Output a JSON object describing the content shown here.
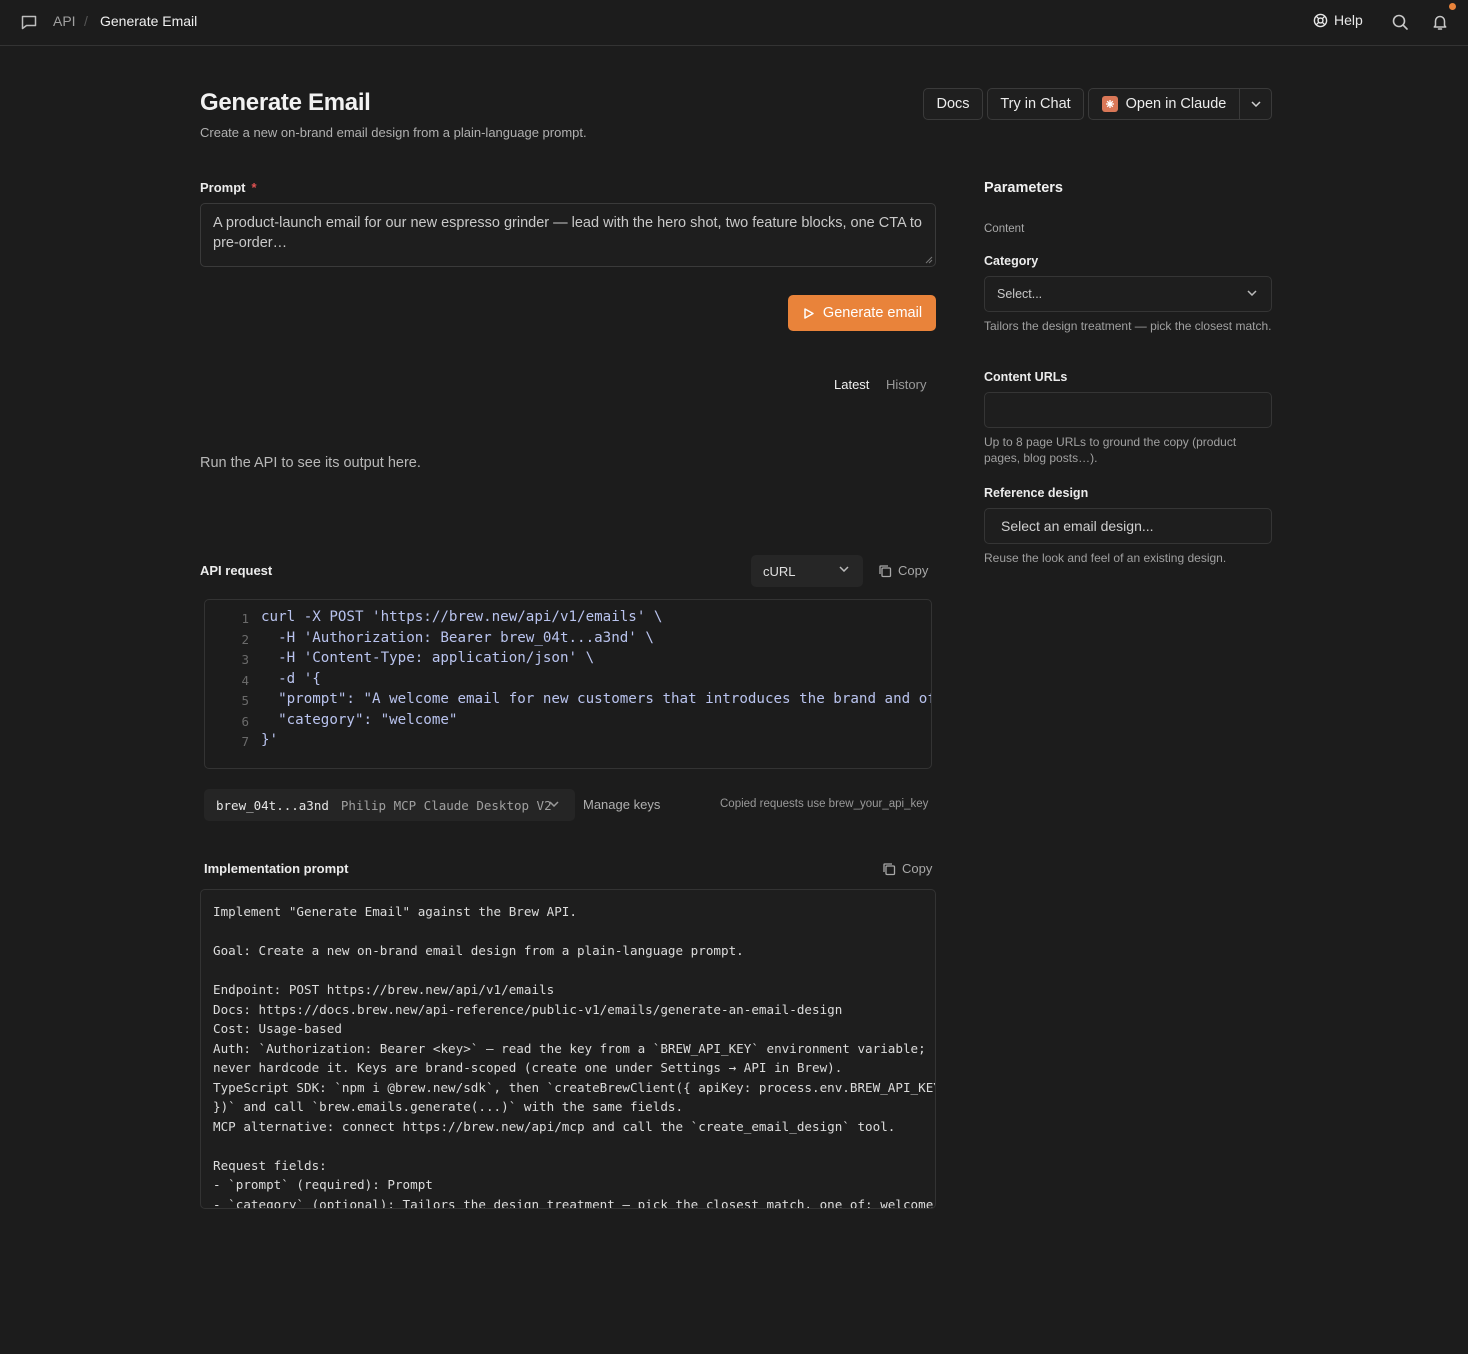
{
  "topbar": {
    "breadcrumb_root": "API",
    "breadcrumb_separator": "/",
    "breadcrumb_current": "Generate Email",
    "help_label": "Help",
    "icons": [
      "chat-bubble-icon",
      "lifebuoy-icon",
      "search-icon",
      "bell-icon"
    ],
    "notification_dot_color": "#e9833a"
  },
  "header": {
    "title": "Generate Email",
    "subtitle": "Create a new on-brand email design from a plain-language prompt.",
    "docs_label": "Docs",
    "try_chat_label": "Try in Chat",
    "open_claude_label": "Open in Claude"
  },
  "prompt": {
    "label": "Prompt",
    "required_mark": "*",
    "value": "A product-launch email for our new espresso grinder — lead with the hero shot, two feature blocks, one CTA to pre-order…",
    "generate_label": "Generate email"
  },
  "output": {
    "tab_latest": "Latest",
    "tab_history": "History",
    "empty_message": "Run the API to see its output here."
  },
  "api_request": {
    "label": "API request",
    "language": "cURL",
    "copy_label": "Copy",
    "code_lines": [
      "curl -X POST 'https://brew.new/api/v1/emails' \\",
      "  -H 'Authorization: Bearer brew_04t...a3nd' \\",
      "  -H 'Content-Type: application/json' \\",
      "  -d '{",
      "  \"prompt\": \"A welcome email for new customers that introduces the brand and offers",
      "  \"category\": \"welcome\"",
      "}'"
    ],
    "line_numbers": [
      "1",
      "2",
      "3",
      "4",
      "5",
      "6",
      "7"
    ],
    "key_id": "brew_04t...a3nd",
    "key_name": "Philip MCP Claude Desktop V2",
    "manage_keys_label": "Manage keys",
    "copied_note": "Copied requests use brew_your_api_key"
  },
  "implementation": {
    "label": "Implementation prompt",
    "copy_label": "Copy",
    "text": "Implement \"Generate Email\" against the Brew API.\n\nGoal: Create a new on-brand email design from a plain-language prompt.\n\nEndpoint: POST https://brew.new/api/v1/emails\nDocs: https://docs.brew.new/api-reference/public-v1/emails/generate-an-email-design\nCost: Usage-based\nAuth: `Authorization: Bearer <key>` — read the key from a `BREW_API_KEY` environment variable;\nnever hardcode it. Keys are brand-scoped (create one under Settings → API in Brew).\nTypeScript SDK: `npm i @brew.new/sdk`, then `createBrewClient({ apiKey: process.env.BREW_API_KEY\n})` and call `brew.emails.generate(...)` with the same fields.\nMCP alternative: connect https://brew.new/api/mcp and call the `create_email_design` tool.\n\nRequest fields:\n- `prompt` (required): Prompt\n- `category` (optional): Tailors the design treatment — pick the closest match, one of: welcome,"
  },
  "parameters": {
    "title": "Parameters",
    "section": "Content",
    "category_label": "Category",
    "category_value": "Select...",
    "category_help": "Tailors the design treatment — pick the closest match.",
    "urls_label": "Content URLs",
    "urls_value": "",
    "urls_help": "Up to 8 page URLs to ground the copy (product pages, blog posts…).",
    "reference_label": "Reference design",
    "reference_placeholder": "Select an email design...",
    "reference_help": "Reuse the look and feel of an existing design."
  },
  "colors": {
    "accent": "#e9833a",
    "background": "#1c1c1c",
    "code_text": "#b9c3ee",
    "claude_brand": "#d97757"
  }
}
